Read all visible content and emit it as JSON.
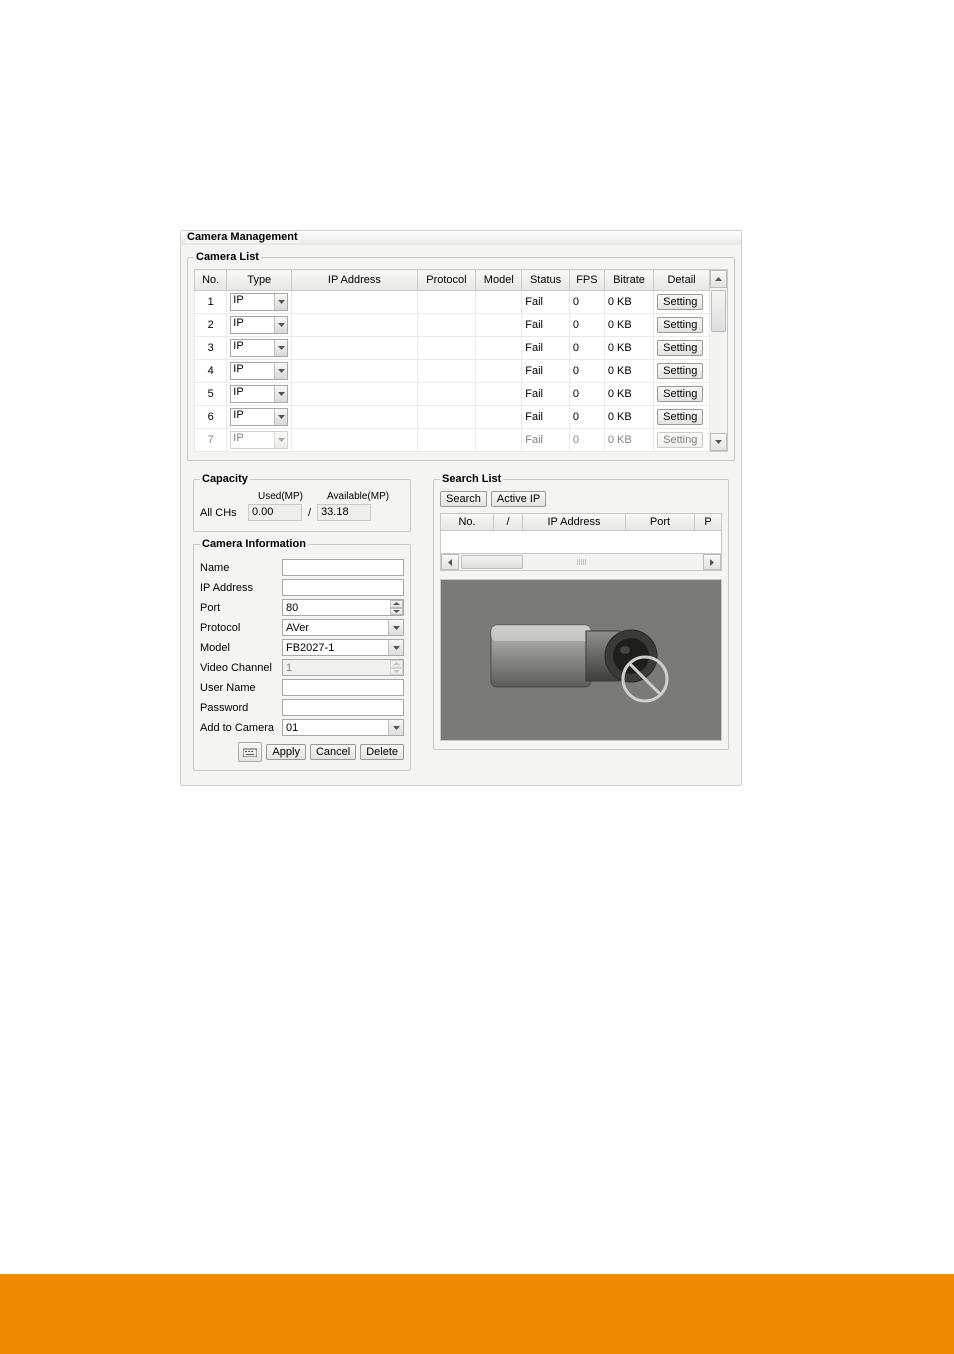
{
  "title": "Camera Management",
  "camera_list": {
    "legend": "Camera List",
    "headers": {
      "no": "No.",
      "type": "Type",
      "ip": "IP Address",
      "protocol": "Protocol",
      "model": "Model",
      "status": "Status",
      "fps": "FPS",
      "bitrate": "Bitrate",
      "detail": "Detail"
    },
    "rows": [
      {
        "no": "1",
        "type": "IP",
        "ip": "",
        "protocol": "",
        "model": "",
        "status": "Fail",
        "fps": "0",
        "bitrate": "0 KB",
        "detail": "Setting"
      },
      {
        "no": "2",
        "type": "IP",
        "ip": "",
        "protocol": "",
        "model": "",
        "status": "Fail",
        "fps": "0",
        "bitrate": "0 KB",
        "detail": "Setting"
      },
      {
        "no": "3",
        "type": "IP",
        "ip": "",
        "protocol": "",
        "model": "",
        "status": "Fail",
        "fps": "0",
        "bitrate": "0 KB",
        "detail": "Setting"
      },
      {
        "no": "4",
        "type": "IP",
        "ip": "",
        "protocol": "",
        "model": "",
        "status": "Fail",
        "fps": "0",
        "bitrate": "0 KB",
        "detail": "Setting"
      },
      {
        "no": "5",
        "type": "IP",
        "ip": "",
        "protocol": "",
        "model": "",
        "status": "Fail",
        "fps": "0",
        "bitrate": "0 KB",
        "detail": "Setting"
      },
      {
        "no": "6",
        "type": "IP",
        "ip": "",
        "protocol": "",
        "model": "",
        "status": "Fail",
        "fps": "0",
        "bitrate": "0 KB",
        "detail": "Setting"
      },
      {
        "no": "7",
        "type": "IP",
        "ip": "",
        "protocol": "",
        "model": "",
        "status": "Fail",
        "fps": "0",
        "bitrate": "0 KB",
        "detail": "Setting"
      }
    ]
  },
  "capacity": {
    "legend": "Capacity",
    "all_chs_label": "All CHs",
    "used_label": "Used(MP)",
    "available_label": "Available(MP)",
    "used": "0.00",
    "sep": "/",
    "available": "33.18"
  },
  "camera_info": {
    "legend": "Camera Information",
    "name_label": "Name",
    "name": "",
    "ip_label": "IP Address",
    "ip": "",
    "port_label": "Port",
    "port": "80",
    "protocol_label": "Protocol",
    "protocol": "AVer",
    "model_label": "Model",
    "model": "FB2027-1",
    "video_ch_label": "Video Channel",
    "video_ch": "1",
    "user_label": "User Name",
    "user": "",
    "pass_label": "Password",
    "pass": "",
    "add_label": "Add to Camera",
    "add": "01",
    "apply": "Apply",
    "cancel": "Cancel",
    "delete": "Delete"
  },
  "search_list": {
    "legend": "Search List",
    "search_btn": "Search",
    "activeip_btn": "Active IP",
    "headers": {
      "no": "No.",
      "sep": "/",
      "ip": "IP Address",
      "port": "Port",
      "p": "P"
    }
  }
}
